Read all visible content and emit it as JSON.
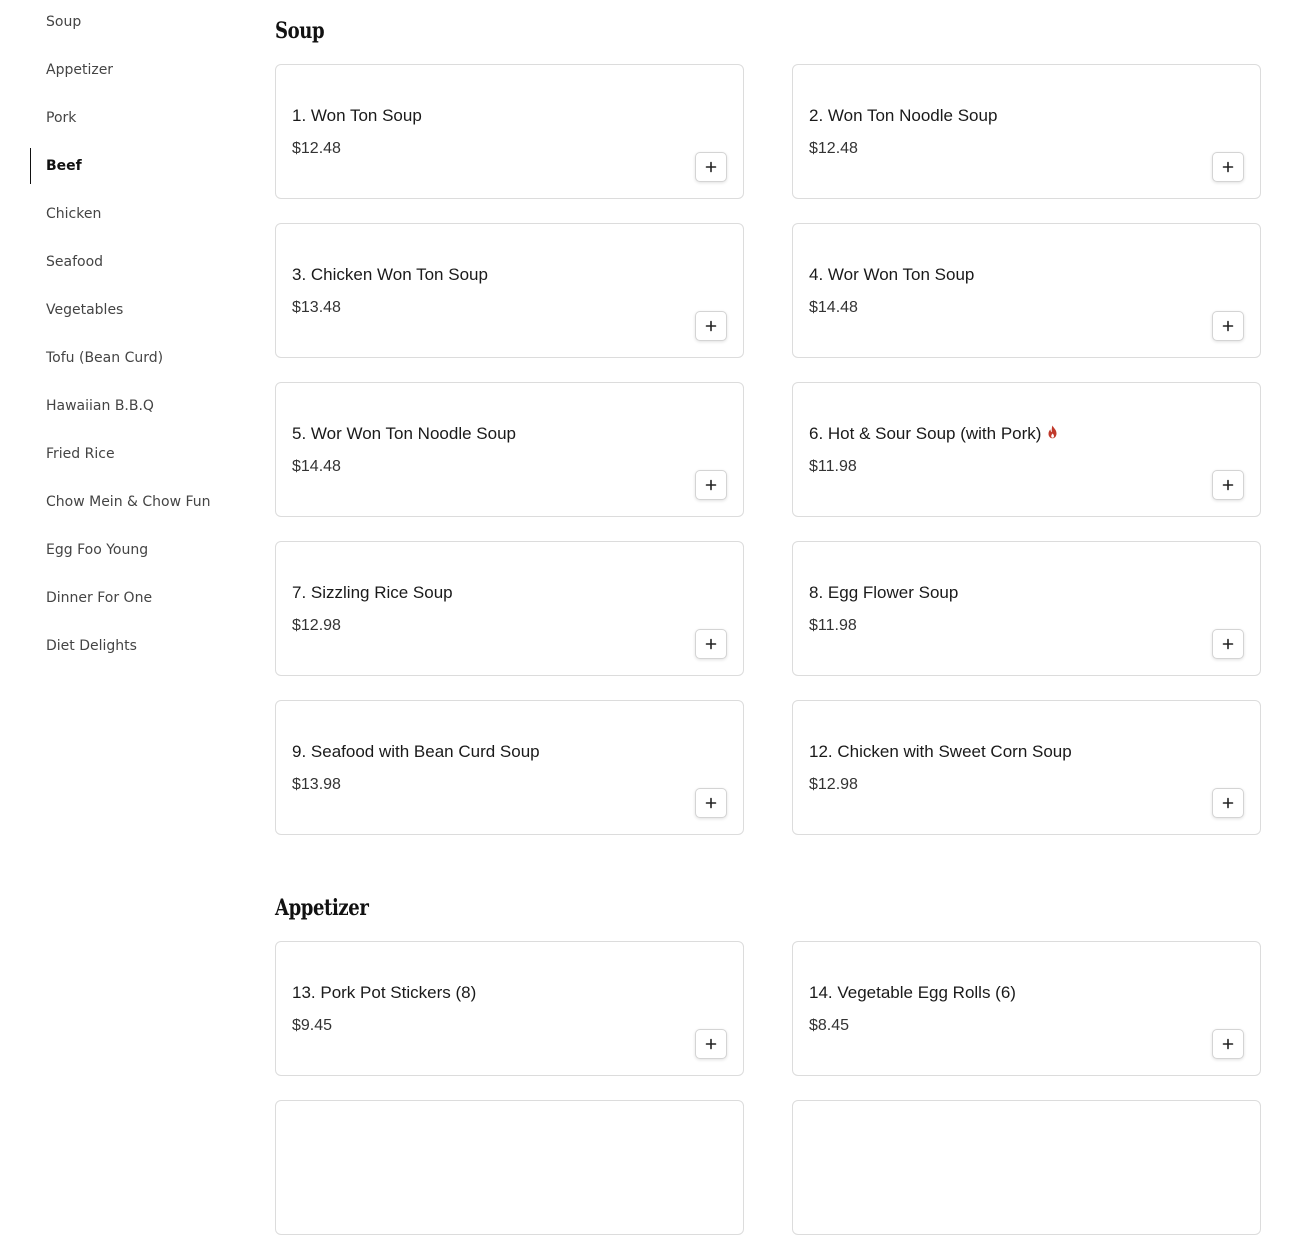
{
  "sidebar": {
    "items": [
      {
        "label": "Soup"
      },
      {
        "label": "Appetizer"
      },
      {
        "label": "Pork"
      },
      {
        "label": "Beef",
        "active": true
      },
      {
        "label": "Chicken"
      },
      {
        "label": "Seafood"
      },
      {
        "label": "Vegetables"
      },
      {
        "label": "Tofu (Bean Curd)"
      },
      {
        "label": "Hawaiian B.B.Q"
      },
      {
        "label": "Fried Rice"
      },
      {
        "label": "Chow Mein & Chow Fun"
      },
      {
        "label": "Egg Foo Young"
      },
      {
        "label": "Dinner For One"
      },
      {
        "label": "Diet Delights"
      }
    ]
  },
  "sections": [
    {
      "title": "Soup",
      "items": [
        {
          "name": "1. Won Ton Soup",
          "price": "$12.48"
        },
        {
          "name": "2. Won Ton Noodle Soup",
          "price": "$12.48"
        },
        {
          "name": "3. Chicken Won Ton Soup",
          "price": "$13.48"
        },
        {
          "name": "4. Wor Won Ton Soup",
          "price": "$14.48"
        },
        {
          "name": "5. Wor Won Ton Noodle Soup",
          "price": "$14.48"
        },
        {
          "name": "6. Hot & Sour Soup (with Pork)",
          "price": "$11.98",
          "spicy": true
        },
        {
          "name": "7. Sizzling Rice Soup",
          "price": "$12.98"
        },
        {
          "name": "8. Egg Flower Soup",
          "price": "$11.98"
        },
        {
          "name": "9. Seafood with Bean Curd Soup",
          "price": "$13.98"
        },
        {
          "name": "12. Chicken with Sweet Corn Soup",
          "price": "$12.98"
        }
      ]
    },
    {
      "title": "Appetizer",
      "items": [
        {
          "name": "13. Pork Pot Stickers (8)",
          "price": "$9.45"
        },
        {
          "name": "14. Vegetable Egg Rolls (6)",
          "price": "$8.45"
        }
      ]
    }
  ],
  "colors": {
    "spicy_icon": "#c0392b",
    "active_indicator": "#111111",
    "card_border": "#dcdcdc"
  },
  "icons": {
    "add": "plus-icon",
    "spicy": "flame-icon"
  }
}
